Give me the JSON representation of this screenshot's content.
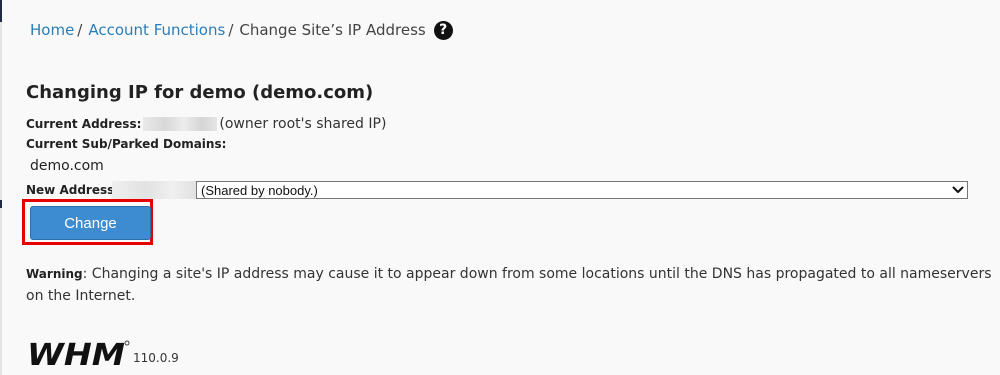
{
  "breadcrumb": {
    "items": [
      {
        "label": "Home",
        "sep": "/"
      },
      {
        "label": "Account Functions",
        "sep": "/"
      }
    ],
    "current": "Change Site’s IP Address",
    "help_glyph": "?"
  },
  "page": {
    "title": "Changing IP for demo (demo.com)"
  },
  "details": {
    "current_address_label": "Current Address:",
    "current_address_note": "(owner root's shared IP)",
    "subdomains_label": "Current Sub/Parked Domains:",
    "domain": "demo.com",
    "new_address_label": "New Address:"
  },
  "new_address_select": {
    "selected_text": "(Shared by nobody.)"
  },
  "actions": {
    "change_label": "Change"
  },
  "warning": {
    "label": "Warning",
    "text": ": Changing a site's IP address may cause it to appear down from some locations until the DNS has propagated to all nameservers on the Internet."
  },
  "footer": {
    "logo_text": "WHM",
    "version": "110.0.9"
  },
  "colors": {
    "link": "#2a7db8",
    "button": "#3d8bd0",
    "highlight": "#e60000",
    "background": "#f9f9f9"
  }
}
